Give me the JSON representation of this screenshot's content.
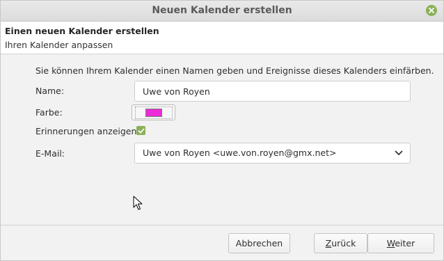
{
  "window": {
    "title": "Neuen Kalender erstellen"
  },
  "header": {
    "title": "Einen neuen Kalender erstellen",
    "subtitle": "Ihren Kalender anpassen"
  },
  "form": {
    "intro": "Sie können Ihrem Kalender einen Namen geben und Ereignisse dieses Kalenders einfärben.",
    "name_label": "Name:",
    "name_value": "Uwe von Royen",
    "color_label": "Farbe:",
    "color_value": "#ea2bd7",
    "reminders_label": "Erinnerungen anzeigen:",
    "reminders_checked": true,
    "email_label": "E-Mail:",
    "email_value": "Uwe von Royen <uwe.von.royen@gmx.net>"
  },
  "buttons": {
    "cancel": "Abbrechen",
    "back_first": "Z",
    "back_rest": "urück",
    "next_first": "W",
    "next_rest": "eiter"
  },
  "colors": {
    "accent": "#8bb158",
    "titlebar": "#dcdcdc",
    "dialog_bg": "#f2f2f2"
  }
}
